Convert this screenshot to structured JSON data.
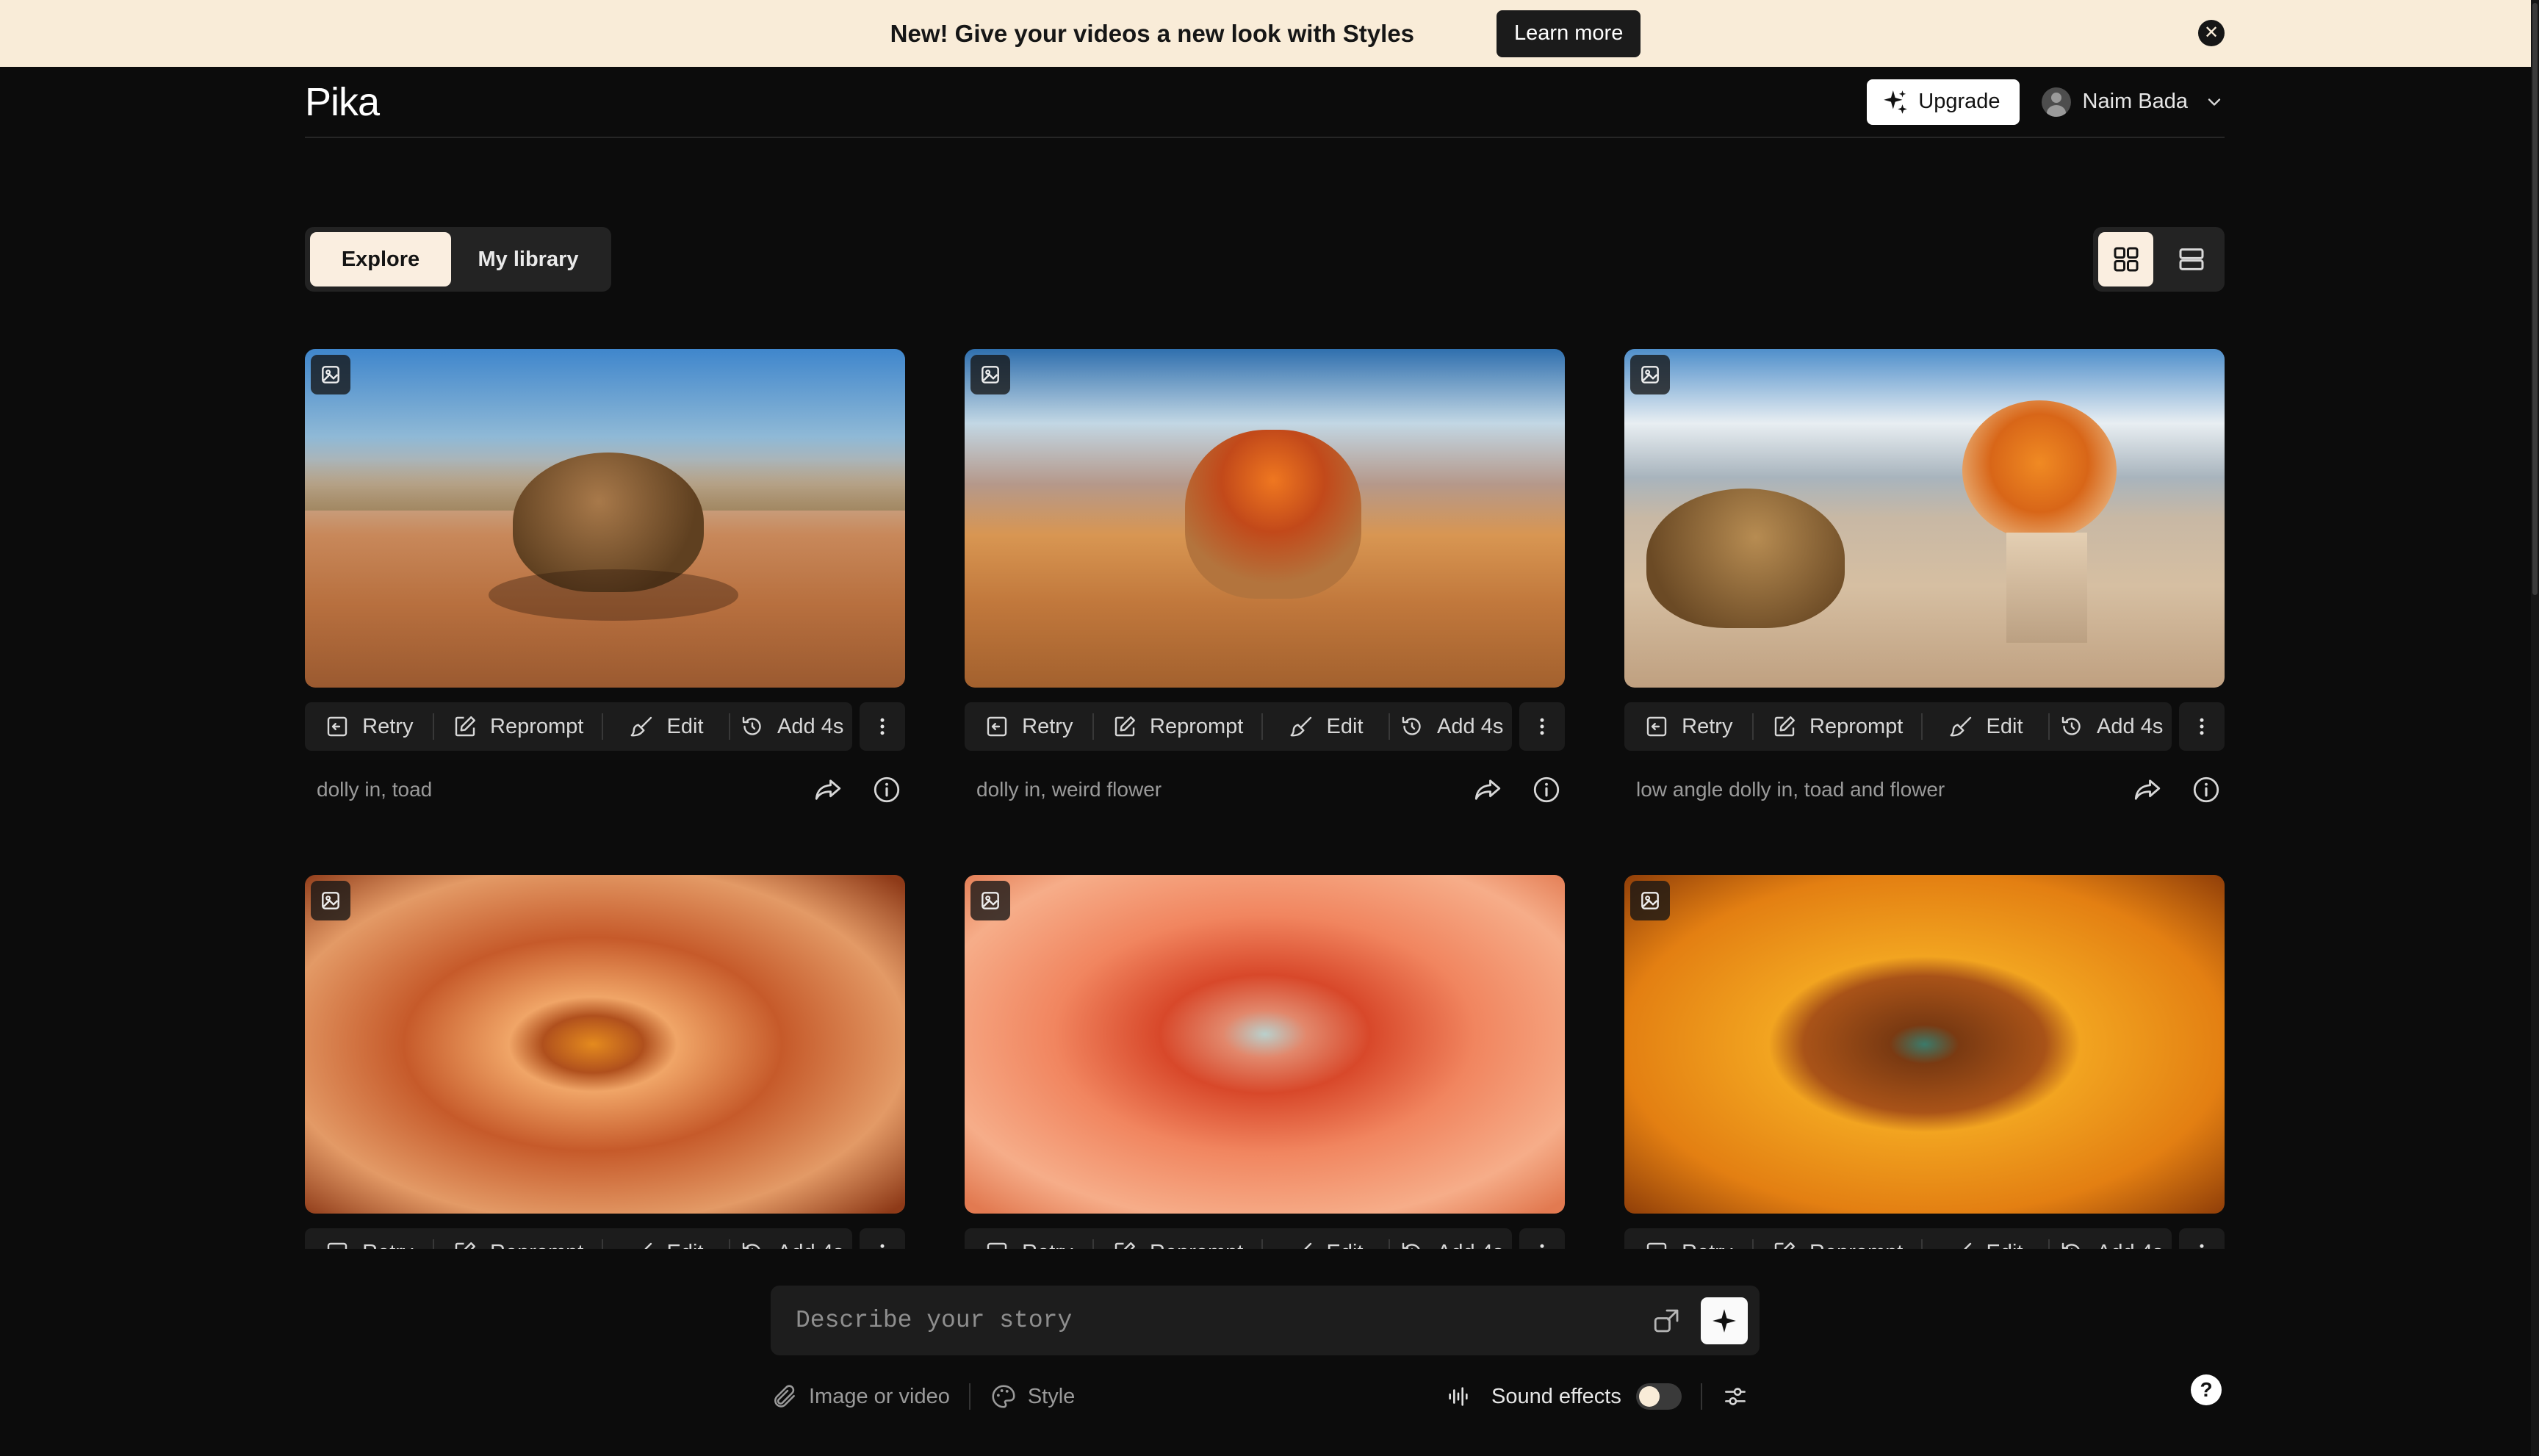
{
  "banner": {
    "message": "New! Give your videos a new look with Styles",
    "button_label": "Learn more",
    "close_icon": "close-icon"
  },
  "header": {
    "logo": "Pika",
    "upgrade_label": "Upgrade",
    "user_name": "Naim Bada"
  },
  "tabs": {
    "explore": "Explore",
    "library": "My library",
    "active": "Explore"
  },
  "view_modes": {
    "grid_icon": "grid-view-icon",
    "list_icon": "list-view-icon",
    "active": "grid"
  },
  "card_actions": {
    "retry": "Retry",
    "reprompt": "Reprompt",
    "edit": "Edit",
    "add": "Add 4s"
  },
  "cards": [
    {
      "prompt": "dolly in, toad",
      "scene": "desert toad"
    },
    {
      "prompt": "dolly in, weird flower",
      "scene": "desert flower"
    },
    {
      "prompt": "low angle dolly in, toad and flower",
      "scene": "toad and flower"
    },
    {
      "prompt": "",
      "scene": "orange dahlia"
    },
    {
      "prompt": "",
      "scene": "coral dahlia"
    },
    {
      "prompt": "",
      "scene": "sunflower"
    }
  ],
  "composer": {
    "placeholder": "Describe your story",
    "attach_label": "Image or video",
    "style_label": "Style",
    "sound_label": "Sound effects",
    "sound_enabled": false
  },
  "help": {
    "label": "?"
  },
  "colors": {
    "background": "#0c0c0c",
    "banner": "#f9ecd8",
    "active_tab": "#faeee0",
    "surface": "#1c1c1c"
  }
}
